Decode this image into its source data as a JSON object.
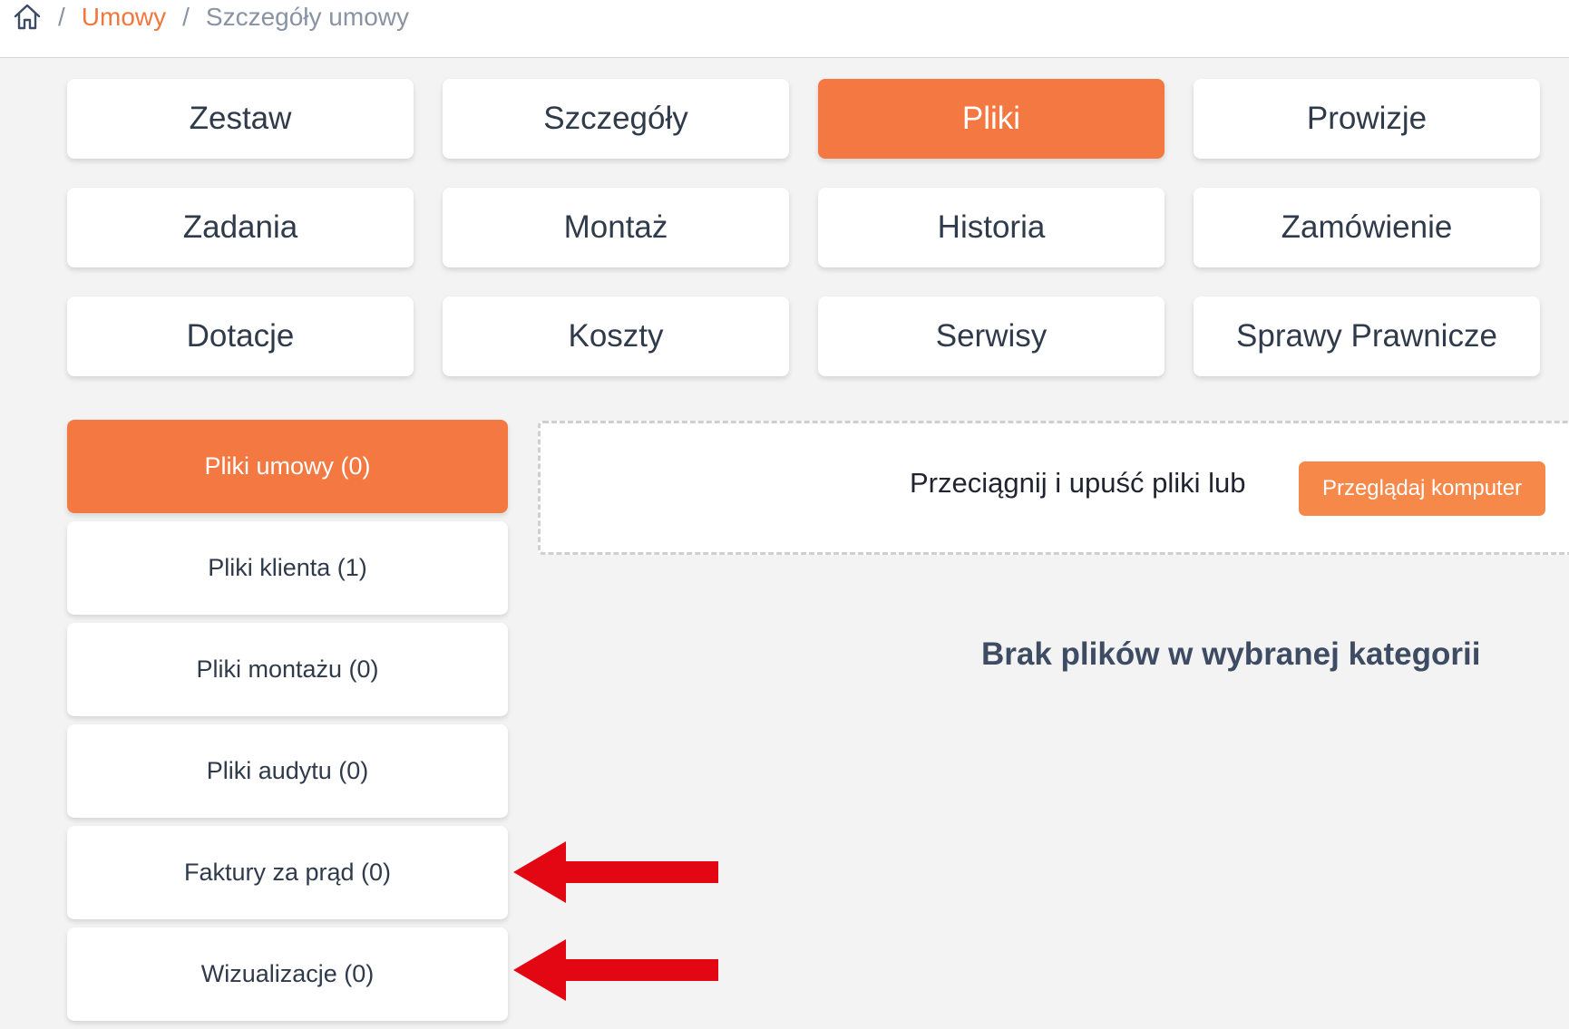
{
  "breadcrumb": {
    "separator": "/",
    "items": [
      "Umowy",
      "Szczegóły umowy"
    ]
  },
  "tabs": [
    "Zestaw",
    "Szczegóły",
    "Pliki",
    "Prowizje",
    "Zadania",
    "Montaż",
    "Historia",
    "Zamówienie",
    "Dotacje",
    "Koszty",
    "Serwisy",
    "Sprawy Prawnicze"
  ],
  "active_tab": "Pliki",
  "categories": [
    "Pliki umowy (0)",
    "Pliki klienta (1)",
    "Pliki montażu (0)",
    "Pliki audytu (0)",
    "Faktury za prąd (0)",
    "Wizualizacje (0)"
  ],
  "active_category": "Pliki umowy (0)",
  "upload": {
    "prompt": "Przeciągnij i upuść pliki lub",
    "button": "Przeglądaj komputer"
  },
  "empty_message": "Brak plików w wybranej kategorii",
  "colors": {
    "accent": "#f37841",
    "button_accent": "#f6894a",
    "annotation_arrow": "#e30613",
    "text": "#2f3a4b"
  }
}
